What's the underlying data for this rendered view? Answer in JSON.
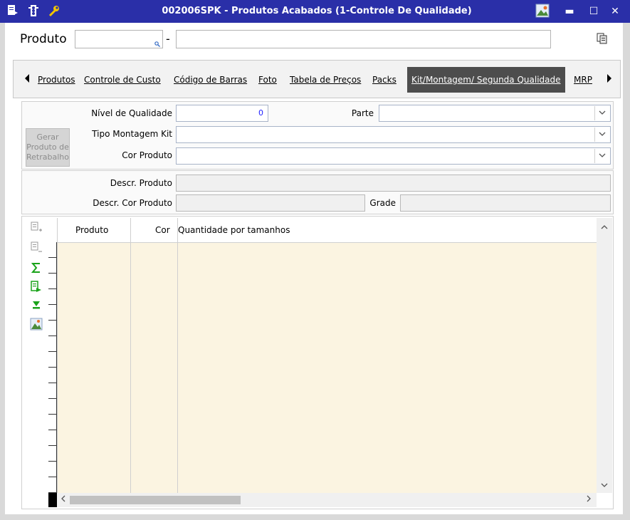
{
  "window": {
    "title": "002006SPK - Produtos Acabados (1-Controle De Qualidade)",
    "controls": {
      "minimize": "▬",
      "maximize": "☐",
      "close": "✕"
    }
  },
  "header": {
    "produto_label": "Produto",
    "produto_code": "",
    "dash": "-",
    "produto_desc": ""
  },
  "tabs": [
    {
      "label": "Produtos"
    },
    {
      "label": "Controle de Custo"
    },
    {
      "label": "Código de Barras"
    },
    {
      "label": "Foto"
    },
    {
      "label": "Tabela de Preços"
    },
    {
      "label": "Packs"
    },
    {
      "label": "Kit/Montagem/ Segunda Qualidade"
    },
    {
      "label": "MRP"
    }
  ],
  "form": {
    "nivel_qualidade_label": "Nível de Qualidade",
    "nivel_qualidade_value": "0",
    "parte_label": "Parte",
    "tipo_montagem_label": "Tipo Montagem Kit",
    "cor_produto_label": "Cor Produto",
    "gerar_button": "Gerar Produto de Retrabalho",
    "descr_produto_label": "Descr. Produto",
    "descr_cor_label": "Descr. Cor Produto",
    "grade_label": "Grade"
  },
  "grid": {
    "columns": [
      "Produto",
      "Cor",
      "Quantidade por tamanhos"
    ]
  },
  "colors": {
    "titlebar": "#2a2fa8",
    "active_tab": "#4d4d4d",
    "grid_bg": "#fbf4e1"
  }
}
